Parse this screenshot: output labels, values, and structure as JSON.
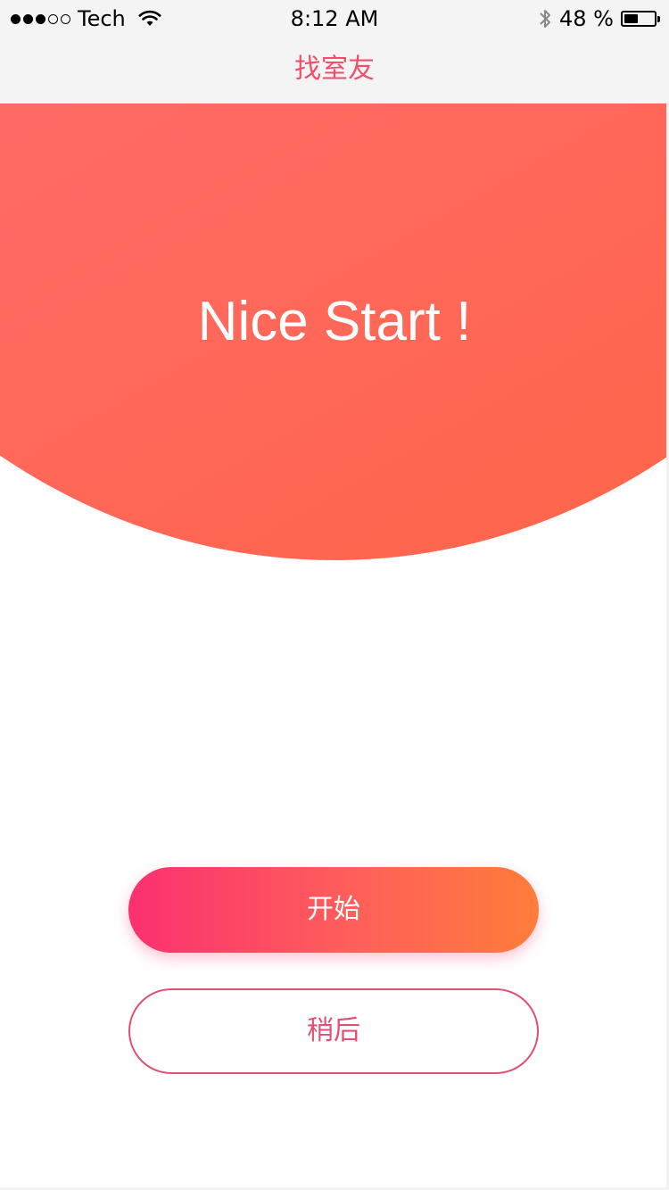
{
  "status_bar": {
    "carrier": "Tech",
    "signal_bars_filled": 3,
    "signal_bars_total": 5,
    "time": "8:12 AM",
    "battery_percent": "48 %",
    "battery_level": 0.48
  },
  "nav": {
    "title": "找室友"
  },
  "hero": {
    "headline": "Nice Start !"
  },
  "actions": {
    "start_label": "开始",
    "later_label": "稍后"
  },
  "colors": {
    "accent": "#ef4f6a",
    "hero_gradient_start": "#ff6a8a",
    "hero_gradient_end": "#ff6445",
    "button_gradient_start": "#fb3070",
    "button_gradient_end": "#ff7d3a",
    "outline_button": "#e05074"
  },
  "icons": {
    "wifi": "wifi-icon",
    "bluetooth": "bluetooth-icon",
    "battery": "battery-icon"
  }
}
